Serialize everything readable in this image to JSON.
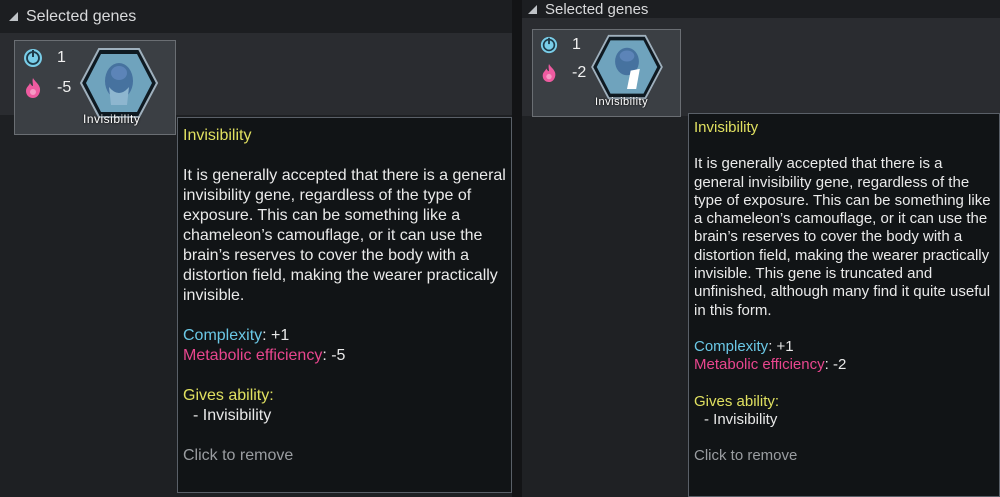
{
  "panels": [
    {
      "header": "Selected genes",
      "gene": {
        "complexity": "1",
        "metabolic": "-5",
        "name": "Invisibility"
      },
      "tooltip": {
        "title": "Invisibility",
        "description": "It is generally accepted that there is a general invisibility gene, regardless of the type of exposure. This can be something like a chameleon’s camouflage, or it can use the brain’s reserves to cover the body with a distortion field, making the wearer practically invisible.",
        "complexity_label": "Complexity",
        "complexity_value": ": +1",
        "metabolic_label": "Metabolic efficiency",
        "metabolic_value": ": -5",
        "gives_ability_label": "Gives ability:",
        "ability": "- Invisibility",
        "click_hint": "Click to remove"
      }
    },
    {
      "header": "Selected genes",
      "gene": {
        "complexity": "1",
        "metabolic": "-2",
        "name": "Invisibility"
      },
      "tooltip": {
        "title": "Invisibility",
        "description": "It is generally accepted that there is a general invisibility gene, regardless of the type of exposure. This can be something like a chameleon’s camouflage, or it can use the brain’s reserves to cover the body with a distortion field, making the wearer practically invisible. This gene is truncated and unfinished, although many find it quite useful in this form.",
        "complexity_label": "Complexity",
        "complexity_value": ": +1",
        "metabolic_label": "Metabolic efficiency",
        "metabolic_value": ": -2",
        "gives_ability_label": "Gives ability:",
        "ability": "- Invisibility",
        "click_hint": "Click to remove"
      }
    }
  ],
  "icons": {
    "collapse": "collapse-triangle-icon",
    "complexity": "complexity-power-icon",
    "metabolic": "metabolic-flame-icon",
    "gene": "gene-hexagon-icon"
  },
  "colors": {
    "title_yellow": "#e0e060",
    "complexity_cyan": "#6bc8e6",
    "metabolic_pink": "#e8468e"
  }
}
